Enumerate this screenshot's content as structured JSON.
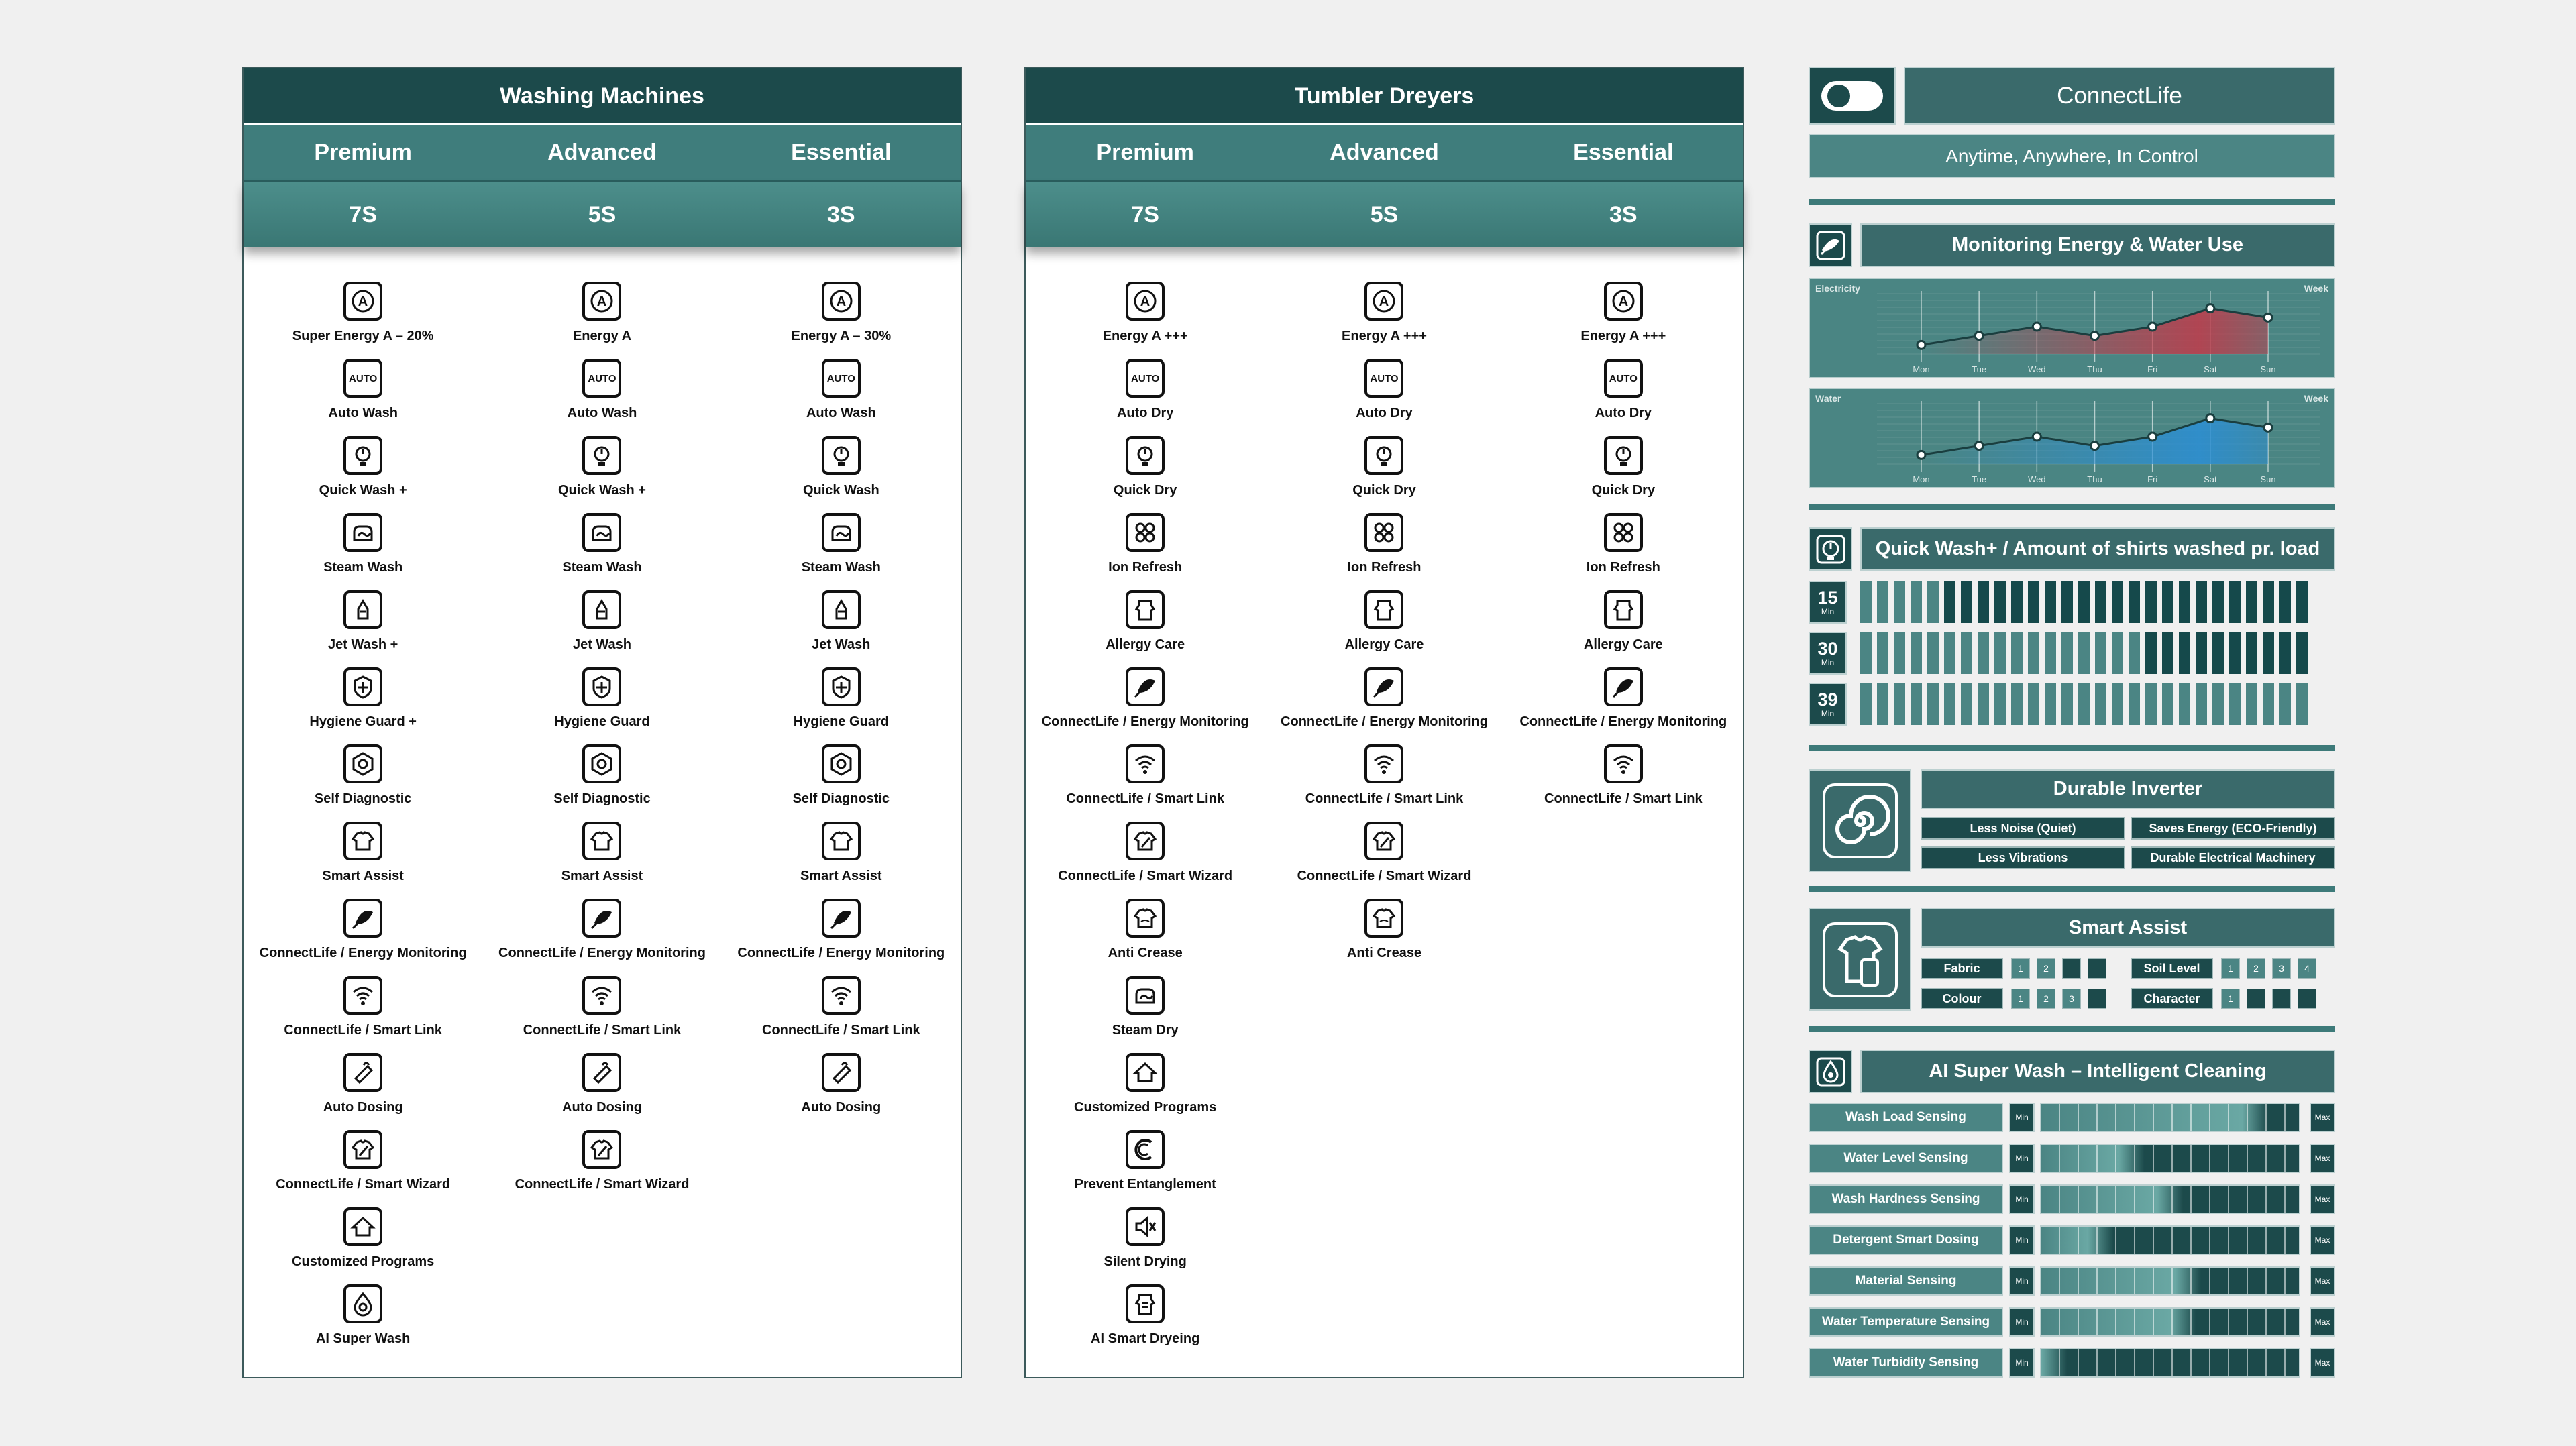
{
  "washing": {
    "title": "Washing Machines",
    "tiers": [
      "Premium",
      "Advanced",
      "Essential"
    ],
    "models": [
      "7S",
      "5S",
      "3S"
    ],
    "columns": [
      [
        {
          "icon": "energy-icon",
          "label": "Super Energy A – 20%"
        },
        {
          "icon": "auto-programme-icon",
          "label": "Auto Wash"
        },
        {
          "icon": "quick-timer-icon",
          "label": "Quick Wash +"
        },
        {
          "icon": "steam-icon",
          "label": "Steam Wash"
        },
        {
          "icon": "jet-icon",
          "label": "Jet Wash +"
        },
        {
          "icon": "hygiene-icon",
          "label": "Hygiene Guard +"
        },
        {
          "icon": "diagnostic-icon",
          "label": "Self Diagnostic"
        },
        {
          "icon": "shirt-icon",
          "label": "Smart Assist"
        },
        {
          "icon": "energy-monitoring-icon",
          "label": "ConnectLife / Energy Monitoring"
        },
        {
          "icon": "wifi-icon",
          "label": "ConnectLife / Smart Link"
        },
        {
          "icon": "dosing-icon",
          "label": "Auto Dosing"
        },
        {
          "icon": "wizard-icon",
          "label": "ConnectLife / Smart Wizard"
        },
        {
          "icon": "home-icon",
          "label": "Customized Programs"
        },
        {
          "icon": "drop-icon",
          "label": "AI Super Wash"
        }
      ],
      [
        {
          "icon": "energy-icon",
          "label": "Energy A"
        },
        {
          "icon": "auto-programme-icon",
          "label": "Auto Wash"
        },
        {
          "icon": "quick-timer-icon",
          "label": "Quick Wash +"
        },
        {
          "icon": "steam-icon",
          "label": "Steam Wash"
        },
        {
          "icon": "jet-icon",
          "label": "Jet Wash"
        },
        {
          "icon": "hygiene-icon",
          "label": "Hygiene Guard"
        },
        {
          "icon": "diagnostic-icon",
          "label": "Self Diagnostic"
        },
        {
          "icon": "shirt-icon",
          "label": "Smart Assist"
        },
        {
          "icon": "energy-monitoring-icon",
          "label": "ConnectLife / Energy Monitoring"
        },
        {
          "icon": "wifi-icon",
          "label": "ConnectLife / Smart Link"
        },
        {
          "icon": "dosing-icon",
          "label": "Auto Dosing"
        },
        {
          "icon": "wizard-icon",
          "label": "ConnectLife / Smart Wizard"
        }
      ],
      [
        {
          "icon": "energy-icon",
          "label": "Energy A – 30%"
        },
        {
          "icon": "auto-programme-icon",
          "label": "Auto Wash"
        },
        {
          "icon": "quick-timer-icon",
          "label": "Quick Wash"
        },
        {
          "icon": "steam-icon",
          "label": "Steam Wash"
        },
        {
          "icon": "jet-icon",
          "label": "Jet Wash"
        },
        {
          "icon": "hygiene-icon",
          "label": "Hygiene Guard"
        },
        {
          "icon": "diagnostic-icon",
          "label": "Self Diagnostic"
        },
        {
          "icon": "shirt-icon",
          "label": "Smart Assist"
        },
        {
          "icon": "energy-monitoring-icon",
          "label": "ConnectLife / Energy Monitoring"
        },
        {
          "icon": "wifi-icon",
          "label": "ConnectLife / Smart Link"
        },
        {
          "icon": "dosing-icon",
          "label": "Auto Dosing"
        }
      ]
    ]
  },
  "dryers": {
    "title": "Tumbler Dreyers",
    "tiers": [
      "Premium",
      "Advanced",
      "Essential"
    ],
    "models": [
      "7S",
      "5S",
      "3S"
    ],
    "columns": [
      [
        {
          "icon": "energy-icon",
          "label": "Energy A +++"
        },
        {
          "icon": "auto-programme-icon",
          "label": "Auto Dry"
        },
        {
          "icon": "quick-timer-icon",
          "label": "Quick Dry"
        },
        {
          "icon": "ion-icon",
          "label": "Ion Refresh"
        },
        {
          "icon": "allergy-icon",
          "label": "Allergy Care"
        },
        {
          "icon": "energy-monitoring-icon",
          "label": "ConnectLife / Energy Monitoring"
        },
        {
          "icon": "wifi-icon",
          "label": "ConnectLife / Smart Link"
        },
        {
          "icon": "wizard-icon",
          "label": "ConnectLife / Smart Wizard"
        },
        {
          "icon": "anti-crease-icon",
          "label": "Anti Crease"
        },
        {
          "icon": "steam-icon",
          "label": "Steam Dry"
        },
        {
          "icon": "home-icon",
          "label": "Customized Programs"
        },
        {
          "icon": "entanglement-icon",
          "label": "Prevent Entanglement"
        },
        {
          "icon": "mute-icon",
          "label": "Silent Drying"
        },
        {
          "icon": "smart-dry-icon",
          "label": "AI Smart Dryeing"
        }
      ],
      [
        {
          "icon": "energy-icon",
          "label": "Energy A +++"
        },
        {
          "icon": "auto-programme-icon",
          "label": "Auto Dry"
        },
        {
          "icon": "quick-timer-icon",
          "label": "Quick Dry"
        },
        {
          "icon": "ion-icon",
          "label": "Ion Refresh"
        },
        {
          "icon": "allergy-icon",
          "label": "Allergy Care"
        },
        {
          "icon": "energy-monitoring-icon",
          "label": "ConnectLife / Energy Monitoring"
        },
        {
          "icon": "wifi-icon",
          "label": "ConnectLife / Smart Link"
        },
        {
          "icon": "wizard-icon",
          "label": "ConnectLife / Smart Wizard"
        },
        {
          "icon": "anti-crease-icon",
          "label": "Anti Crease"
        }
      ],
      [
        {
          "icon": "energy-icon",
          "label": "Energy A +++"
        },
        {
          "icon": "auto-programme-icon",
          "label": "Auto Dry"
        },
        {
          "icon": "quick-timer-icon",
          "label": "Quick Dry"
        },
        {
          "icon": "ion-icon",
          "label": "Ion Refresh"
        },
        {
          "icon": "allergy-icon",
          "label": "Allergy Care"
        },
        {
          "icon": "energy-monitoring-icon",
          "label": "ConnectLife / Energy Monitoring"
        },
        {
          "icon": "wifi-icon",
          "label": "ConnectLife / Smart Link"
        }
      ]
    ]
  },
  "icon_text": {
    "energy": "A",
    "auto": "AUTO"
  },
  "connectlife": {
    "title": "ConnectLife",
    "tagline": "Anytime, Anywhere, In Control",
    "icon": "toggle-icon"
  },
  "monitoring": {
    "title": "Monitoring Energy & Water Use",
    "icon": "energy-monitoring-icon",
    "days": [
      "Mon",
      "Tue",
      "Wed",
      "Thu",
      "Fri",
      "Sat",
      "Sun"
    ],
    "electricity": {
      "label": "Electricity",
      "period": "Week",
      "values": [
        1,
        2,
        3,
        2,
        3,
        5,
        4
      ],
      "color": "#c23a4a"
    },
    "water": {
      "label": "Water",
      "period": "Week",
      "values": [
        1,
        2,
        3,
        2,
        3,
        5,
        4
      ],
      "color": "#2b8fd6"
    }
  },
  "quickwash": {
    "title": "Quick Wash+ / Amount of shirts washed pr. load",
    "icon": "quick-timer-icon",
    "unit": "Min",
    "total": 27,
    "rows": [
      {
        "minutes": "15",
        "light": 5
      },
      {
        "minutes": "30",
        "light": 17
      },
      {
        "minutes": "39",
        "light": 27
      }
    ],
    "colors": {
      "light": "#4b8584",
      "dark": "#15494b"
    }
  },
  "inverter": {
    "title": "Durable Inverter",
    "icon": "spiral-icon",
    "benefits": [
      "Less Noise (Quiet)",
      "Saves Energy (ECO-Friendly)",
      "Less Vibrations",
      "Durable Electrical Machinery"
    ]
  },
  "smart_assist": {
    "title": "Smart Assist",
    "icon": "shirt-phone-icon",
    "fabric": {
      "label": "Fabric",
      "levels": [
        "1",
        "2",
        "",
        ""
      ]
    },
    "soil": {
      "label": "Soil Level",
      "levels": [
        "1",
        "2",
        "3",
        "4"
      ]
    },
    "colour": {
      "label": "Colour",
      "levels": [
        "1",
        "2",
        "3",
        ""
      ]
    },
    "character": {
      "label": "Character",
      "levels": [
        "1",
        "",
        "",
        ""
      ]
    }
  },
  "ai_wash": {
    "title": "AI Super Wash – Intelligent Cleaning",
    "icon": "drop-icon",
    "min_label": "Min",
    "max_label": "Max",
    "sensors": [
      {
        "label": "Wash Load Sensing",
        "level": 0.88
      },
      {
        "label": "Water Level Sensing",
        "level": 0.4
      },
      {
        "label": "Wash Hardness Sensing",
        "level": 0.55
      },
      {
        "label": "Detergent Smart Dosing",
        "level": 0.28
      },
      {
        "label": "Material Sensing",
        "level": 0.62
      },
      {
        "label": "Water Temperature Sensing",
        "level": 0.6
      },
      {
        "label": "Water Turbidity Sensing",
        "level": 0.1
      }
    ]
  }
}
